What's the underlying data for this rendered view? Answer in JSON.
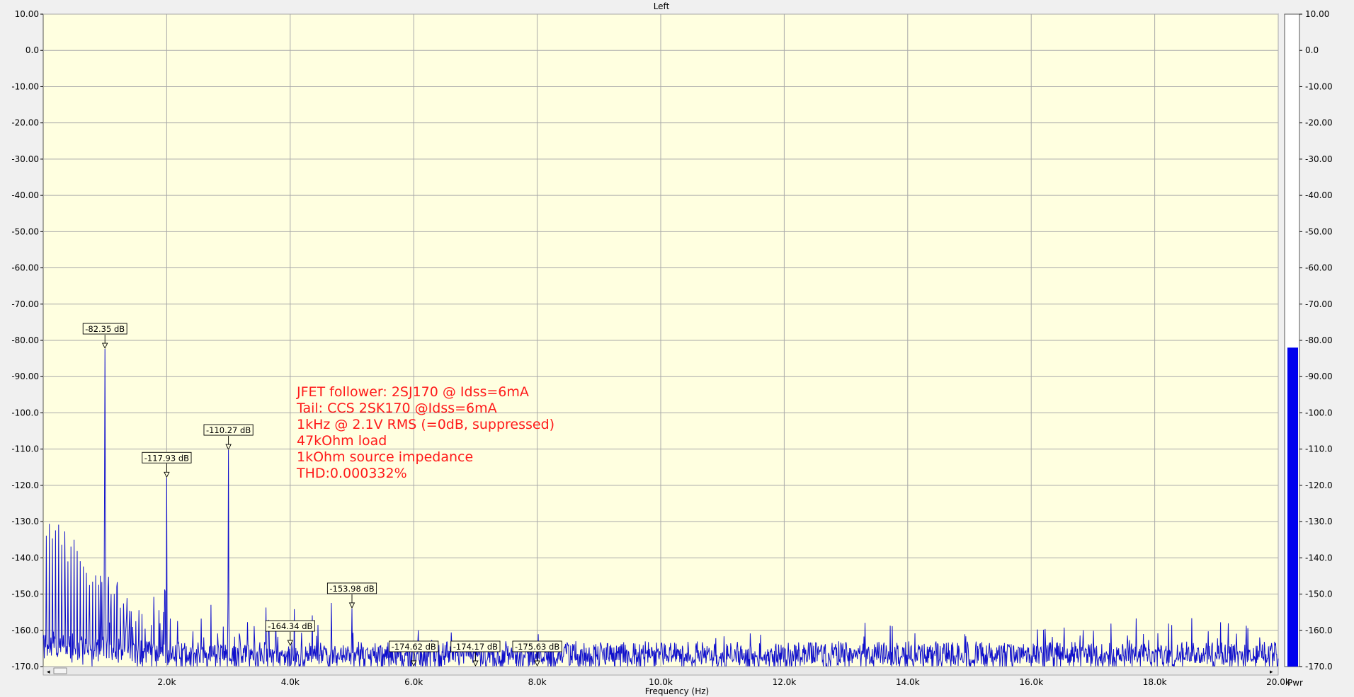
{
  "window": {
    "title": "Left"
  },
  "chart_data": {
    "type": "line",
    "title": "Left",
    "xlabel": "Frequency (Hz)",
    "ylabel": "",
    "xlim": [
      0,
      20000
    ],
    "ylim": [
      -170,
      10
    ],
    "grid": true,
    "x_tick_labels": [
      "2.0k",
      "4.0k",
      "6.0k",
      "8.0k",
      "10.0k",
      "12.0k",
      "14.0k",
      "16.0k",
      "18.0k",
      "20.0k"
    ],
    "x_tick_values": [
      2000,
      4000,
      6000,
      8000,
      10000,
      12000,
      14000,
      16000,
      18000,
      20000
    ],
    "y_tick_labels": [
      "10.00",
      "0.0",
      "-10.00",
      "-20.00",
      "-30.00",
      "-40.00",
      "-50.00",
      "-60.00",
      "-70.00",
      "-80.00",
      "-90.00",
      "-100.0",
      "-110.0",
      "-120.0",
      "-130.0",
      "-140.0",
      "-150.0",
      "-160.0",
      "-170.0"
    ],
    "y_tick_values": [
      10,
      0,
      -10,
      -20,
      -30,
      -40,
      -50,
      -60,
      -70,
      -80,
      -90,
      -100,
      -110,
      -120,
      -130,
      -140,
      -150,
      -160,
      -170
    ],
    "noise_floor_db": -166,
    "spikes": [
      {
        "x": 1000,
        "y": -82.35
      },
      {
        "x": 2000,
        "y": -117.93
      },
      {
        "x": 3000,
        "y": -110.27
      },
      {
        "x": 4000,
        "y": -164.34
      },
      {
        "x": 5000,
        "y": -153.98
      },
      {
        "x": 6000,
        "y": -174.62
      },
      {
        "x": 7000,
        "y": -174.17
      },
      {
        "x": 8000,
        "y": -175.63
      }
    ],
    "markers": [
      {
        "x": 1000,
        "y": -82.35,
        "label": "-82.35 dB"
      },
      {
        "x": 2000,
        "y": -117.93,
        "label": "-117.93 dB"
      },
      {
        "x": 3000,
        "y": -110.27,
        "label": "-110.27 dB"
      },
      {
        "x": 4000,
        "y": -164.34,
        "label": "-164.34 dB"
      },
      {
        "x": 5000,
        "y": -153.98,
        "label": "-153.98 dB"
      },
      {
        "x": 6000,
        "y": -174.62,
        "label": "-174.62 dB"
      },
      {
        "x": 7000,
        "y": -174.17,
        "label": "-174.17 dB"
      },
      {
        "x": 8000,
        "y": -175.63,
        "label": "-175.63 dB"
      }
    ],
    "annotation_lines": [
      "JFET follower: 2SJ170 @ Idss=6mA",
      "Tail: CCS 2SK170 @Idss=6mA",
      "1kHz @ 2.1V RMS (=0dB, suppressed)",
      "47kOhm load",
      "1kOhm source impedance",
      "THD:0.000332%"
    ],
    "power_meter": {
      "label": "Pwr",
      "level_db": -82,
      "ylim": [
        -170,
        10
      ]
    }
  },
  "colors": {
    "plot_bg": "#ffffe0",
    "grid": "#a9a9a9",
    "trace": "#1010cc",
    "annotation": "#ff1a1a",
    "meter_bar": "#0000ee"
  }
}
